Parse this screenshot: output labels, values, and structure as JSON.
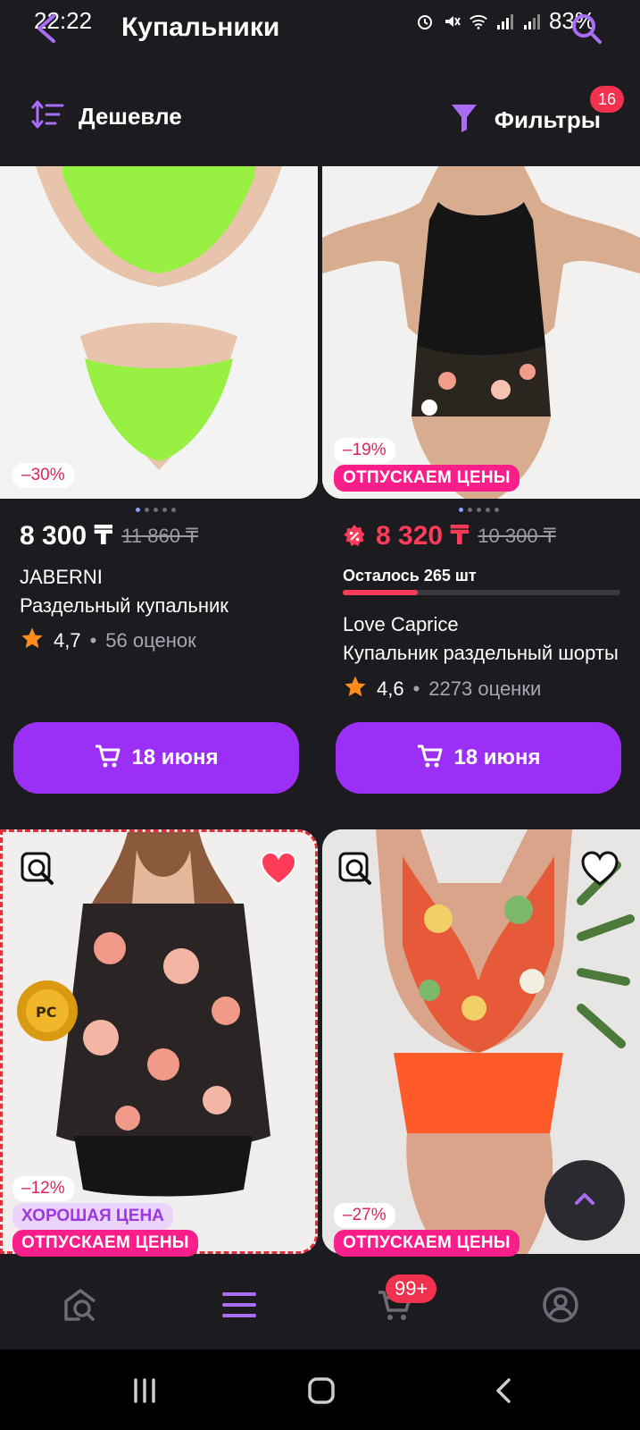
{
  "status_bar": {
    "time": "22:22",
    "battery": "83%"
  },
  "header": {
    "title": "Купальники"
  },
  "toolbar": {
    "sort_label": "Дешевле",
    "filter_label": "Фильтры",
    "filter_count": "16"
  },
  "products": [
    {
      "discount": "–30%",
      "price": "8 300 ₸",
      "old_price": "11 860 ₸",
      "brand": "JABERNI",
      "title": "Раздельный купальник",
      "rating": "4,7",
      "reviews": "56 оценок",
      "delivery": "18 июня"
    },
    {
      "discount": "–19%",
      "promo": "ОТПУСКАЕМ ЦЕНЫ",
      "price": "8 320 ₸",
      "old_price": "10 300 ₸",
      "stock": "Осталось 265 шт",
      "stock_fraction": 0.27,
      "brand": "Love Caprice",
      "title": "Купальник раздельный шорты",
      "rating": "4,6",
      "reviews": "2273 оценки",
      "delivery": "18 июня"
    },
    {
      "discount": "–12%",
      "good_price": "ХОРОШАЯ ЦЕНА",
      "promo": "ОТПУСКАЕМ ЦЕНЫ",
      "favorited": true
    },
    {
      "discount": "–27%",
      "promo": "ОТПУСКАЕМ ЦЕНЫ",
      "favorited": false
    }
  ],
  "bottom_nav": {
    "cart_badge": "99+"
  },
  "colors": {
    "accent": "#9b2ff5",
    "sale_red": "#ff3b5a",
    "promo_pink": "#f91e8a",
    "background": "#1c1b20"
  }
}
